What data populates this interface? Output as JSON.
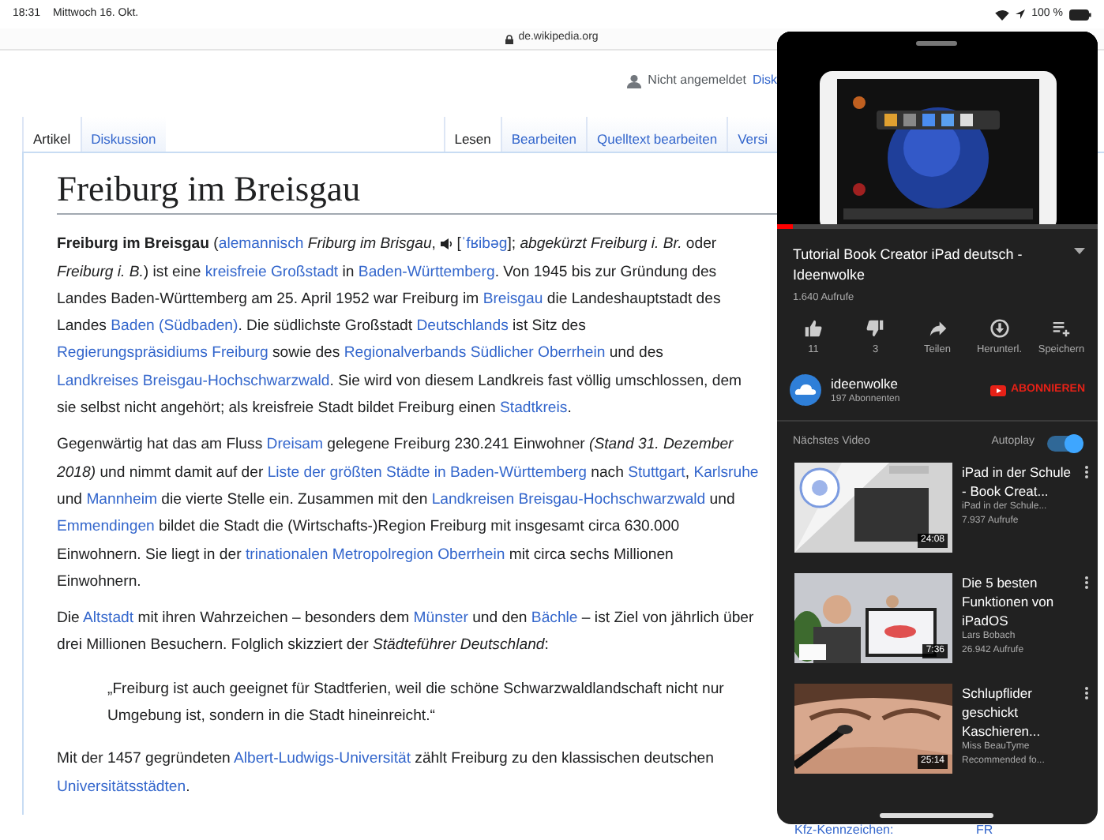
{
  "status_bar": {
    "time": "18:31",
    "date": "Mittwoch 16. Okt.",
    "battery": "100 %"
  },
  "address_bar": {
    "url": "de.wikipedia.org"
  },
  "user_bar": {
    "status": "Nicht angemeldet",
    "link": "Disk"
  },
  "tabs_left": [
    {
      "label": "Artikel",
      "selected": true
    },
    {
      "label": "Diskussion",
      "selected": false
    }
  ],
  "tabs_right": [
    {
      "label": "Lesen",
      "selected": true
    },
    {
      "label": "Bearbeiten",
      "selected": false
    },
    {
      "label": "Quelltext bearbeiten",
      "selected": false
    },
    {
      "label": "Versi",
      "selected": false
    }
  ],
  "article": {
    "title": "Freiburg im Breisgau",
    "paragraphs": [
      {
        "kind": "text",
        "segments": [
          {
            "kind": "text",
            "text": "**Freiburg im Breisgau** ("
          },
          {
            "kind": "link",
            "text": "alemannisch"
          },
          {
            "kind": "text",
            "text": " *Friburg im Brisgau*, "
          },
          {
            "kind": "audio"
          },
          {
            "kind": "text",
            "text": " ["
          },
          {
            "kind": "link",
            "text": "ˈfʁibəg"
          },
          {
            "kind": "text",
            "text": "]; *abgekürzt Freiburg i. Br.* oder *Freiburg i. B.*) ist eine "
          },
          {
            "kind": "link",
            "text": "kreisfreie Großstadt"
          },
          {
            "kind": "text",
            "text": " in "
          },
          {
            "kind": "link",
            "text": "Baden-Württemberg"
          },
          {
            "kind": "text",
            "text": ". Von 1945 bis zur Gründung des Landes Baden-Württemberg am 25. April 1952 war Freiburg im "
          },
          {
            "kind": "link",
            "text": "Breisgau"
          },
          {
            "kind": "text",
            "text": " die Landeshauptstadt des Landes "
          },
          {
            "kind": "link",
            "text": "Baden (Südbaden)"
          },
          {
            "kind": "text",
            "text": ". Die südlichste Großstadt "
          },
          {
            "kind": "link",
            "text": "Deutschlands"
          },
          {
            "kind": "text",
            "text": " ist Sitz des "
          },
          {
            "kind": "link",
            "text": "Regierungspräsidiums Freiburg"
          },
          {
            "kind": "text",
            "text": " sowie des "
          },
          {
            "kind": "link",
            "text": "Regionalverbands Südlicher Oberrhein"
          },
          {
            "kind": "text",
            "text": " und des "
          },
          {
            "kind": "link",
            "text": "Landkreises Breisgau-Hochschwarzwald"
          },
          {
            "kind": "text",
            "text": ". Sie wird von diesem Landkreis fast völlig umschlossen, dem sie selbst nicht angehört; als kreisfreie Stadt bildet Freiburg einen "
          },
          {
            "kind": "link",
            "text": "Stadtkreis"
          },
          {
            "kind": "text",
            "text": "."
          }
        ]
      },
      {
        "kind": "text",
        "segments": [
          {
            "kind": "text",
            "text": "Gegenwärtig hat das am Fluss "
          },
          {
            "kind": "link",
            "text": "Dreisam"
          },
          {
            "kind": "text",
            "text": " gelegene Freiburg 230.241 Einwohner *(Stand 31. Dezember 2018)* und nimmt damit auf der "
          },
          {
            "kind": "link",
            "text": "Liste der größten Städte in Baden-Württemberg"
          },
          {
            "kind": "text",
            "text": " nach "
          },
          {
            "kind": "link",
            "text": "Stuttgart"
          },
          {
            "kind": "text",
            "text": ", "
          },
          {
            "kind": "link",
            "text": "Karlsruhe"
          },
          {
            "kind": "text",
            "text": " und "
          },
          {
            "kind": "link",
            "text": "Mannheim"
          },
          {
            "kind": "text",
            "text": " die vierte Stelle ein. Zusammen mit den "
          },
          {
            "kind": "link",
            "text": "Landkreisen Breisgau-Hochschwarzwald"
          },
          {
            "kind": "text",
            "text": " und "
          },
          {
            "kind": "link",
            "text": "Emmendingen"
          },
          {
            "kind": "text",
            "text": " bildet die Stadt die (Wirtschafts-)Region Freiburg mit insgesamt circa 630.000 Einwohnern. Sie liegt in der "
          },
          {
            "kind": "link",
            "text": "trinationalen Metropolregion Oberrhein"
          },
          {
            "kind": "text",
            "text": " mit circa sechs Millionen Einwohnern."
          }
        ]
      },
      {
        "kind": "text",
        "segments": [
          {
            "kind": "text",
            "text": "Die "
          },
          {
            "kind": "link",
            "text": "Altstadt"
          },
          {
            "kind": "text",
            "text": " mit ihren Wahrzeichen – besonders dem "
          },
          {
            "kind": "link",
            "text": "Münster"
          },
          {
            "kind": "text",
            "text": " und den "
          },
          {
            "kind": "link",
            "text": "Bächle"
          },
          {
            "kind": "text",
            "text": " – ist Ziel von jährlich über drei Millionen Besuchern. Folglich skizziert der *Städteführer Deutschland*:"
          }
        ]
      },
      {
        "kind": "quote",
        "segments": [
          {
            "kind": "text",
            "text": "„Freiburg ist auch geeignet für Stadtferien, weil die schöne Schwarzwaldlandschaft nicht nur Umgebung ist, sondern in die Stadt hineinreicht.“"
          }
        ]
      },
      {
        "kind": "text",
        "segments": [
          {
            "kind": "text",
            "text": "Mit der 1457 gegründeten "
          },
          {
            "kind": "link",
            "text": "Albert-Ludwigs-Universität"
          },
          {
            "kind": "text",
            "text": " zählt Freiburg zu den klassischen deutschen "
          },
          {
            "kind": "link",
            "text": "Universitätsstädten"
          },
          {
            "kind": "text",
            "text": "."
          }
        ]
      }
    ]
  },
  "infobox": [
    {
      "label": "Kfz-Kennzeichen:",
      "value": "FR"
    }
  ],
  "video_panel": {
    "video": {
      "kind": "picture",
      "progress": {
        "level": 0.05
      }
    },
    "title": "Tutorial Book Creator iPad deutsch - Ideenwolke",
    "views": "1.640 Aufrufe",
    "actions": [
      {
        "kind": "like",
        "label": "11"
      },
      {
        "kind": "dislike",
        "label": "3"
      },
      {
        "kind": "share",
        "label": "Teilen"
      },
      {
        "kind": "download",
        "label": "Herunterl."
      },
      {
        "kind": "save",
        "label": "Speichern"
      }
    ],
    "channel": {
      "name": "ideenwolke",
      "subscribers": "197 Abonnenten",
      "subscribe": "ABONNIEREN"
    },
    "next": {
      "heading": "Nächstes Video",
      "autoplay": {
        "label": "Autoplay",
        "on": true
      }
    },
    "recommendations": [
      {
        "kind": "picture",
        "duration": "24:08",
        "title": "iPad in der Schule - Book Creat...",
        "channel": "iPad in der Schule...",
        "views": "7.937 Aufrufe"
      },
      {
        "kind": "picture",
        "duration": "7:36",
        "title": "Die 5 besten Funktionen von iPadOS",
        "channel": "Lars Bobach",
        "views": "26.942 Aufrufe"
      },
      {
        "kind": "picture",
        "duration": "25:14",
        "title": "Schlupflider geschickt Kaschieren...",
        "channel": "Miss BeauTyme",
        "views": "Recommended fo..."
      }
    ]
  }
}
